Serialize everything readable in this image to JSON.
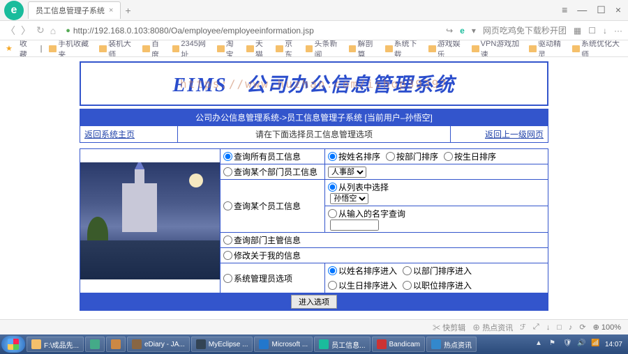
{
  "browser": {
    "tab_title": "员工信息管理子系统",
    "url": "http://192.168.0.103:8080/Oa/employee/employeeinformation.jsp",
    "addr_hint": "网页吃鸡免下载秒开团",
    "bookmarks": [
      "收藏",
      "手机收藏夹",
      "装机大师",
      "百度",
      "2345网址",
      "淘宝",
      "天猫",
      "京东",
      "头条新闻",
      "解剖算",
      "系统下载",
      "游戏娱乐",
      "VPN游戏加速",
      "驱动精灵",
      "系统优化大师"
    ]
  },
  "banner": {
    "logo": "EIMS",
    "title": "公司办公信息管理系统",
    "watermark": "https://www.huzhan.com/ishop39397"
  },
  "nav": {
    "breadcrumb": "公司办公信息管理系统->员工信息管理子系统 [当前用户–孙悟空]",
    "back_home": "返回系统主页",
    "instruction": "请在下面选择员工信息管理选项",
    "back_up": "返回上一级网页"
  },
  "options": {
    "row1_main": "查询所有员工信息",
    "row1_sorts": [
      "按姓名排序",
      "按部门排序",
      "按生日排序"
    ],
    "row2_main": "查询某个部门员工信息",
    "row2_select": "人事部",
    "row3_main": "查询某个员工信息",
    "row3_sub1": "从列表中选择",
    "row3_select": "孙悟空",
    "row3_sub2": "从输入的名字查询",
    "row4_main": "查询部门主管信息",
    "row5_main": "修改关于我的信息",
    "row6_main": "系统管理员选项",
    "row6_subs": [
      "以姓名排序进入",
      "以部门排序进入",
      "以生日排序进入",
      "以职位排序进入"
    ]
  },
  "submit": "进入选项",
  "status": {
    "items": [
      "快剪辑",
      "热点资讯"
    ],
    "zoom": "100%"
  },
  "taskbar": {
    "items": [
      "F:\\成品先...",
      "",
      "",
      "eDiary - JA...",
      "MyEclipse ...",
      "Microsoft ...",
      "员工信息...",
      "Bandicam",
      "热点资讯"
    ],
    "time": "14:07"
  }
}
